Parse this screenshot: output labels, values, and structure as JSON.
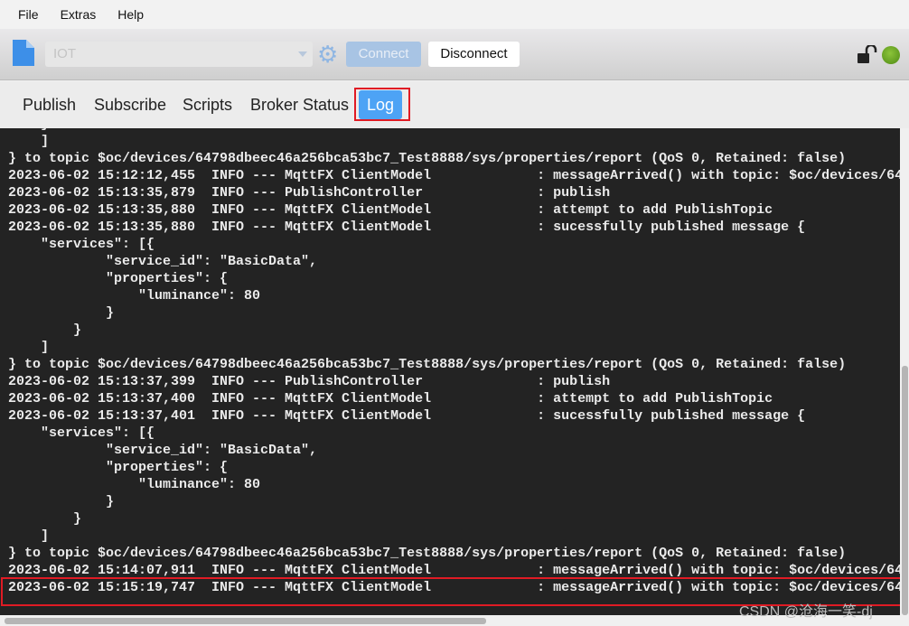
{
  "menu": [
    "File",
    "Extras",
    "Help"
  ],
  "toolbar": {
    "profile": "IOT",
    "connect": "Connect",
    "disconnect": "Disconnect",
    "status_color": "#6aa82a"
  },
  "tabs": [
    "Publish",
    "Subscribe",
    "Scripts",
    "Broker Status",
    "Log"
  ],
  "active_tab": "Log",
  "log_lines": [
    "    }",
    "    ]",
    "} to topic $oc/devices/64798dbeec46a256bca53bc7_Test8888/sys/properties/report (QoS 0, Retained: false)",
    "2023-06-02 15:12:12,455  INFO --- MqttFX ClientModel             : messageArrived() with topic: $oc/devices/64",
    "2023-06-02 15:13:35,879  INFO --- PublishController              : publish",
    "2023-06-02 15:13:35,880  INFO --- MqttFX ClientModel             : attempt to add PublishTopic",
    "2023-06-02 15:13:35,880  INFO --- MqttFX ClientModel             : sucessfully published message {",
    "    \"services\": [{",
    "            \"service_id\": \"BasicData\",",
    "            \"properties\": {",
    "                \"luminance\": 80",
    "            }",
    "        }",
    "    ]",
    "} to topic $oc/devices/64798dbeec46a256bca53bc7_Test8888/sys/properties/report (QoS 0, Retained: false)",
    "2023-06-02 15:13:37,399  INFO --- PublishController              : publish",
    "2023-06-02 15:13:37,400  INFO --- MqttFX ClientModel             : attempt to add PublishTopic",
    "2023-06-02 15:13:37,401  INFO --- MqttFX ClientModel             : sucessfully published message {",
    "    \"services\": [{",
    "            \"service_id\": \"BasicData\",",
    "            \"properties\": {",
    "                \"luminance\": 80",
    "            }",
    "        }",
    "    ]",
    "} to topic $oc/devices/64798dbeec46a256bca53bc7_Test8888/sys/properties/report (QoS 0, Retained: false)",
    "2023-06-02 15:14:07,911  INFO --- MqttFX ClientModel             : messageArrived() with topic: $oc/devices/64",
    "2023-06-02 15:15:19,747  INFO --- MqttFX ClientModel             : messageArrived() with topic: $oc/devices/64"
  ],
  "watermark": "CSDN @沧海一笑-dj"
}
